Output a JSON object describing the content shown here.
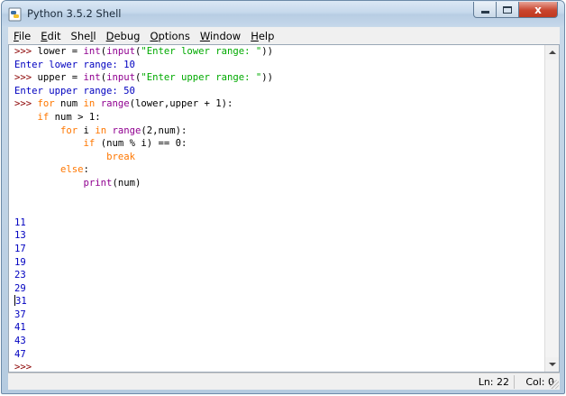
{
  "window": {
    "title": "Python 3.5.2 Shell",
    "close_glyph": "x"
  },
  "menu": {
    "items": [
      {
        "label": "File",
        "underline": "F",
        "rest": "ile"
      },
      {
        "label": "Edit",
        "underline": "E",
        "rest": "dit"
      },
      {
        "label": "Shell",
        "pre": "She",
        "underline": "l",
        "rest": "l"
      },
      {
        "label": "Debug",
        "underline": "D",
        "rest": "ebug"
      },
      {
        "label": "Options",
        "underline": "O",
        "rest": "ptions"
      },
      {
        "label": "Window",
        "underline": "W",
        "rest": "indow"
      },
      {
        "label": "Help",
        "underline": "H",
        "rest": "elp"
      }
    ]
  },
  "shell": {
    "lines": [
      [
        {
          "t": ">>> ",
          "c": "prompt"
        },
        {
          "t": "lower = ",
          "c": ""
        },
        {
          "t": "int",
          "c": "bi"
        },
        {
          "t": "(",
          "c": ""
        },
        {
          "t": "input",
          "c": "bi"
        },
        {
          "t": "(",
          "c": ""
        },
        {
          "t": "\"Enter lower range: \"",
          "c": "str"
        },
        {
          "t": "))",
          "c": ""
        }
      ],
      [
        {
          "t": "Enter lower range: 10",
          "c": "out"
        }
      ],
      [
        {
          "t": ">>> ",
          "c": "prompt"
        },
        {
          "t": "upper = ",
          "c": ""
        },
        {
          "t": "int",
          "c": "bi"
        },
        {
          "t": "(",
          "c": ""
        },
        {
          "t": "input",
          "c": "bi"
        },
        {
          "t": "(",
          "c": ""
        },
        {
          "t": "\"Enter upper range: \"",
          "c": "str"
        },
        {
          "t": "))",
          "c": ""
        }
      ],
      [
        {
          "t": "Enter upper range: 50",
          "c": "out"
        }
      ],
      [
        {
          "t": ">>> ",
          "c": "prompt"
        },
        {
          "t": "for",
          "c": "kw"
        },
        {
          "t": " num ",
          "c": ""
        },
        {
          "t": "in",
          "c": "kw"
        },
        {
          "t": " ",
          "c": ""
        },
        {
          "t": "range",
          "c": "bi"
        },
        {
          "t": "(lower,upper + 1):",
          "c": ""
        }
      ],
      [
        {
          "t": "    ",
          "c": ""
        },
        {
          "t": "if",
          "c": "kw"
        },
        {
          "t": " num > 1:",
          "c": ""
        }
      ],
      [
        {
          "t": "        ",
          "c": ""
        },
        {
          "t": "for",
          "c": "kw"
        },
        {
          "t": " i ",
          "c": ""
        },
        {
          "t": "in",
          "c": "kw"
        },
        {
          "t": " ",
          "c": ""
        },
        {
          "t": "range",
          "c": "bi"
        },
        {
          "t": "(2,num):",
          "c": ""
        }
      ],
      [
        {
          "t": "            ",
          "c": ""
        },
        {
          "t": "if",
          "c": "kw"
        },
        {
          "t": " (num % i) == 0:",
          "c": ""
        }
      ],
      [
        {
          "t": "                ",
          "c": ""
        },
        {
          "t": "break",
          "c": "kw"
        }
      ],
      [
        {
          "t": "        ",
          "c": ""
        },
        {
          "t": "else",
          "c": "kw"
        },
        {
          "t": ":",
          "c": ""
        }
      ],
      [
        {
          "t": "            ",
          "c": ""
        },
        {
          "t": "print",
          "c": "bi"
        },
        {
          "t": "(num)",
          "c": ""
        }
      ],
      [],
      [],
      [
        {
          "t": "11",
          "c": "out"
        }
      ],
      [
        {
          "t": "13",
          "c": "out"
        }
      ],
      [
        {
          "t": "17",
          "c": "out"
        }
      ],
      [
        {
          "t": "19",
          "c": "out"
        }
      ],
      [
        {
          "t": "23",
          "c": "out"
        }
      ],
      [
        {
          "t": "29",
          "c": "out"
        }
      ],
      [
        {
          "t": "31",
          "c": "out",
          "cursor": true
        }
      ],
      [
        {
          "t": "37",
          "c": "out"
        }
      ],
      [
        {
          "t": "41",
          "c": "out"
        }
      ],
      [
        {
          "t": "43",
          "c": "out"
        }
      ],
      [
        {
          "t": "47",
          "c": "out"
        }
      ],
      [
        {
          "t": ">>> ",
          "c": "prompt"
        }
      ]
    ]
  },
  "status": {
    "line": "Ln: 22",
    "col": "Col: 0"
  },
  "colors": {
    "prompt": "#8b0000",
    "keyword": "#ff7700",
    "builtin": "#900090",
    "string": "#00aa00",
    "output": "#0000c0"
  }
}
